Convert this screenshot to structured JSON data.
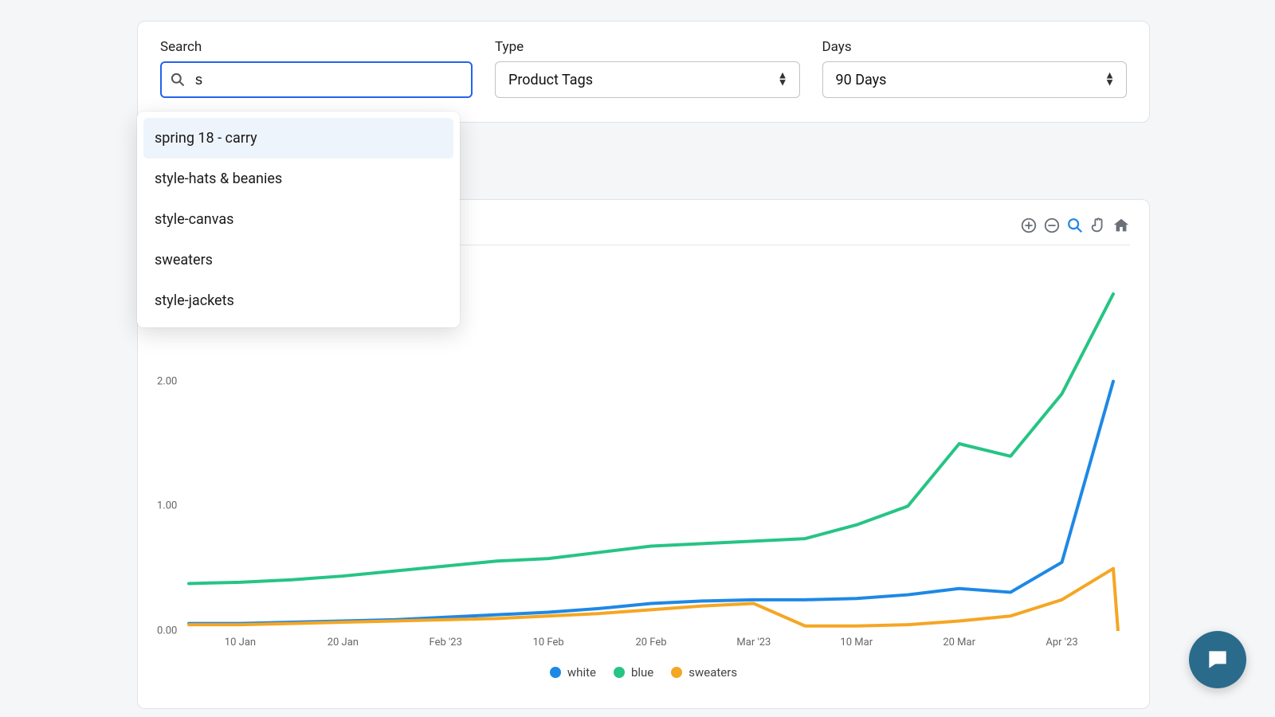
{
  "filters": {
    "search": {
      "label": "Search",
      "value": "s"
    },
    "type": {
      "label": "Type",
      "value": "Product Tags"
    },
    "days": {
      "label": "Days",
      "value": "90 Days"
    }
  },
  "suggestions": [
    "spring 18 - carry",
    "style-hats & beanies",
    "style-canvas",
    "sweaters",
    "style-jackets"
  ],
  "chart_data": {
    "type": "line",
    "xlabel": "",
    "ylabel": "",
    "ylim": [
      0,
      3
    ],
    "y_ticks": [
      "0.00",
      "1.00",
      "2.00"
    ],
    "categories": [
      "10 Jan",
      "20 Jan",
      "Feb '23",
      "10 Feb",
      "20 Feb",
      "Mar '23",
      "10 Mar",
      "20 Mar",
      "Apr '23"
    ],
    "legend": [
      "white",
      "blue",
      "sweaters"
    ],
    "colors": {
      "white": "#1e88e5",
      "blue": "#26c485",
      "sweaters": "#f5a623"
    },
    "series": [
      {
        "name": "white",
        "values": [
          0.06,
          0.06,
          0.07,
          0.08,
          0.09,
          0.11,
          0.13,
          0.15,
          0.18,
          0.22,
          0.24,
          0.25,
          0.25,
          0.26,
          0.29,
          0.34,
          0.31,
          0.55,
          2.0
        ]
      },
      {
        "name": "blue",
        "values": [
          0.38,
          0.39,
          0.41,
          0.44,
          0.48,
          0.52,
          0.56,
          0.58,
          0.63,
          0.68,
          0.7,
          0.72,
          0.74,
          0.85,
          1.0,
          1.5,
          1.4,
          1.9,
          2.7
        ]
      },
      {
        "name": "sweaters",
        "values": [
          0.05,
          0.05,
          0.06,
          0.07,
          0.08,
          0.09,
          0.1,
          0.12,
          0.14,
          0.17,
          0.2,
          0.22,
          0.04,
          0.04,
          0.05,
          0.08,
          0.12,
          0.25,
          0.5
        ]
      }
    ]
  }
}
